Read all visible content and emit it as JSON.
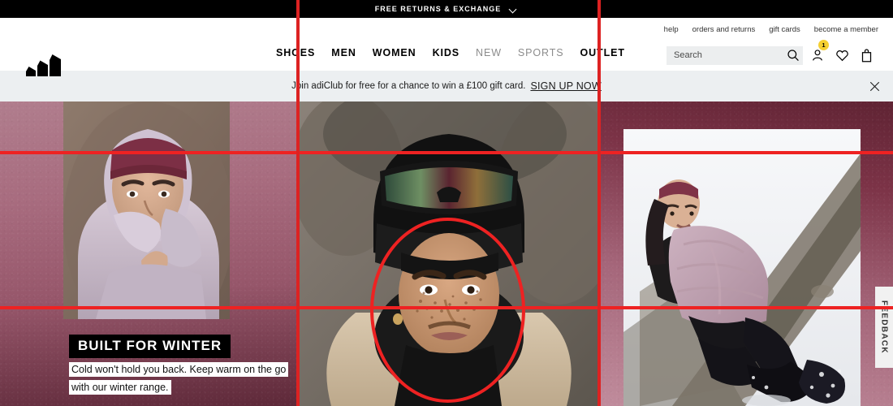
{
  "topbar": {
    "message": "FREE RETURNS & EXCHANGE",
    "chevron_icon": "chevron-down-icon"
  },
  "header": {
    "logo_alt": "adidas",
    "utility_links": [
      {
        "label": "help"
      },
      {
        "label": "orders and returns"
      },
      {
        "label": "gift cards"
      },
      {
        "label": "become a member"
      }
    ],
    "main_nav": [
      {
        "label": "SHOES",
        "dim": false
      },
      {
        "label": "MEN",
        "dim": false
      },
      {
        "label": "WOMEN",
        "dim": false
      },
      {
        "label": "KIDS",
        "dim": false
      },
      {
        "label": "NEW",
        "dim": true
      },
      {
        "label": "SPORTS",
        "dim": true
      },
      {
        "label": "OUTLET",
        "dim": false
      }
    ],
    "search": {
      "placeholder": "Search",
      "value": "",
      "icon": "search-icon"
    },
    "icons": {
      "account": "user-icon",
      "account_badge_count": "1",
      "wishlist": "heart-icon",
      "bag": "shopping-bag-icon"
    }
  },
  "adiclub_banner": {
    "text": "Join adiClub for free for a chance to win a £100 gift card.",
    "link_label": "SIGN UP NOW",
    "close_icon": "close-icon"
  },
  "hero": {
    "caption_title": "BUILT FOR WINTER",
    "caption_subtitle": "Cold won't hold you back. Keep warm on the go with our winter range.",
    "panels": [
      {
        "name": "left-panel",
        "image_alt": "Woman in lilac hooded winter jacket and maroon beanie"
      },
      {
        "name": "center-panel",
        "image_alt": "Person in black beanie with ski goggles and neck warmer"
      },
      {
        "name": "right-panel",
        "image_alt": "Woman in lilac puffer jacket hiking on snowy mountain"
      }
    ]
  },
  "feedback_tab": {
    "label": "FEEDBACK"
  },
  "colors": {
    "topbar_bg": "#000000",
    "banner_bg": "#eceff1",
    "badge": "#f5d033",
    "annotation_red": "#ee2222",
    "hero_pink": "#a86c7f",
    "hero_maroon": "#5d2838"
  }
}
